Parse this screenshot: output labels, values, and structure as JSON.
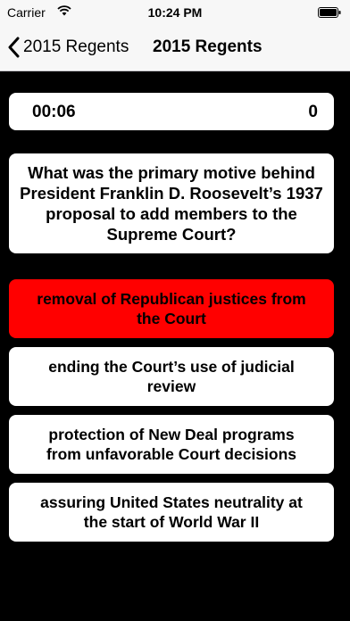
{
  "status_bar": {
    "carrier": "Carrier",
    "time": "10:24 PM",
    "wifi_icon": "wifi-icon",
    "battery_icon": "battery-icon"
  },
  "nav": {
    "back_label": "2015 Regents",
    "title": "2015 Regents",
    "back_icon": "chevron-left-icon"
  },
  "quiz": {
    "timer": "00:06",
    "score": "0",
    "question": "What was the primary motive behind President Franklin D. Roosevelt’s 1937 proposal to add members to the Supreme Court?",
    "answers": [
      {
        "text": "removal of Republican justices from the Court",
        "state": "incorrect"
      },
      {
        "text": "ending the Court’s use of judicial review",
        "state": "default"
      },
      {
        "text": "protection of New Deal programs from unfavorable Court decisions",
        "state": "default"
      },
      {
        "text": "assuring United States neutrality at the start of World War II",
        "state": "default"
      }
    ]
  },
  "colors": {
    "background": "#000000",
    "card": "#ffffff",
    "selected_wrong": "#ff0000",
    "bar": "#f7f7f7"
  }
}
